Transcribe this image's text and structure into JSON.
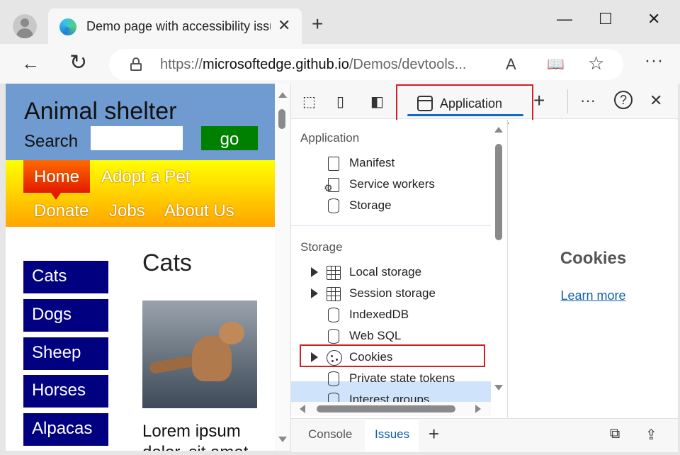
{
  "browser": {
    "tab_title": "Demo page with accessibility issu",
    "tab_close": "✕",
    "new_tab": "+",
    "window_controls": {
      "minimize": "—",
      "maximize": "☐",
      "close": "✕"
    },
    "nav": {
      "back": "←",
      "refresh": "↻"
    },
    "url_prefix": "https://",
    "url_host": "microsoftedge.github.io",
    "url_path": "/Demos/devtools...",
    "read_aloud": "A",
    "immersive": "📖",
    "favorites": "☆",
    "more": "···"
  },
  "page": {
    "title": "Animal shelter",
    "search_label": "Search",
    "search_value": "",
    "go_label": "go",
    "nav": [
      "Home",
      "Adopt a Pet",
      "Donate",
      "Jobs",
      "About Us"
    ],
    "sidebar": [
      "Cats",
      "Dogs",
      "Sheep",
      "Horses",
      "Alpacas"
    ],
    "heading": "Cats",
    "lorem_line1": "Lorem ipsum",
    "lorem_line2": "dolor, sit amet"
  },
  "devtools": {
    "toolbar": {
      "active_tab": "Application",
      "add_tab": "+",
      "more": "···",
      "help": "?",
      "close": "✕"
    },
    "tree": {
      "app_section": "Application",
      "app_items": [
        "Manifest",
        "Service workers",
        "Storage"
      ],
      "storage_section": "Storage",
      "storage_items": [
        "Local storage",
        "Session storage",
        "IndexedDB",
        "Web SQL",
        "Cookies",
        "Private state tokens",
        "Interest groups"
      ]
    },
    "pane": {
      "title": "Cookies",
      "link": "Learn more"
    },
    "drawer": {
      "tabs": [
        "Console",
        "Issues"
      ],
      "add": "+"
    }
  },
  "colors": {
    "highlight_border": "#d0202a",
    "accent": "#0f6cbd",
    "page_header": "#6f9bd1",
    "go_button": "#008000",
    "sidebar_item": "#000080"
  }
}
